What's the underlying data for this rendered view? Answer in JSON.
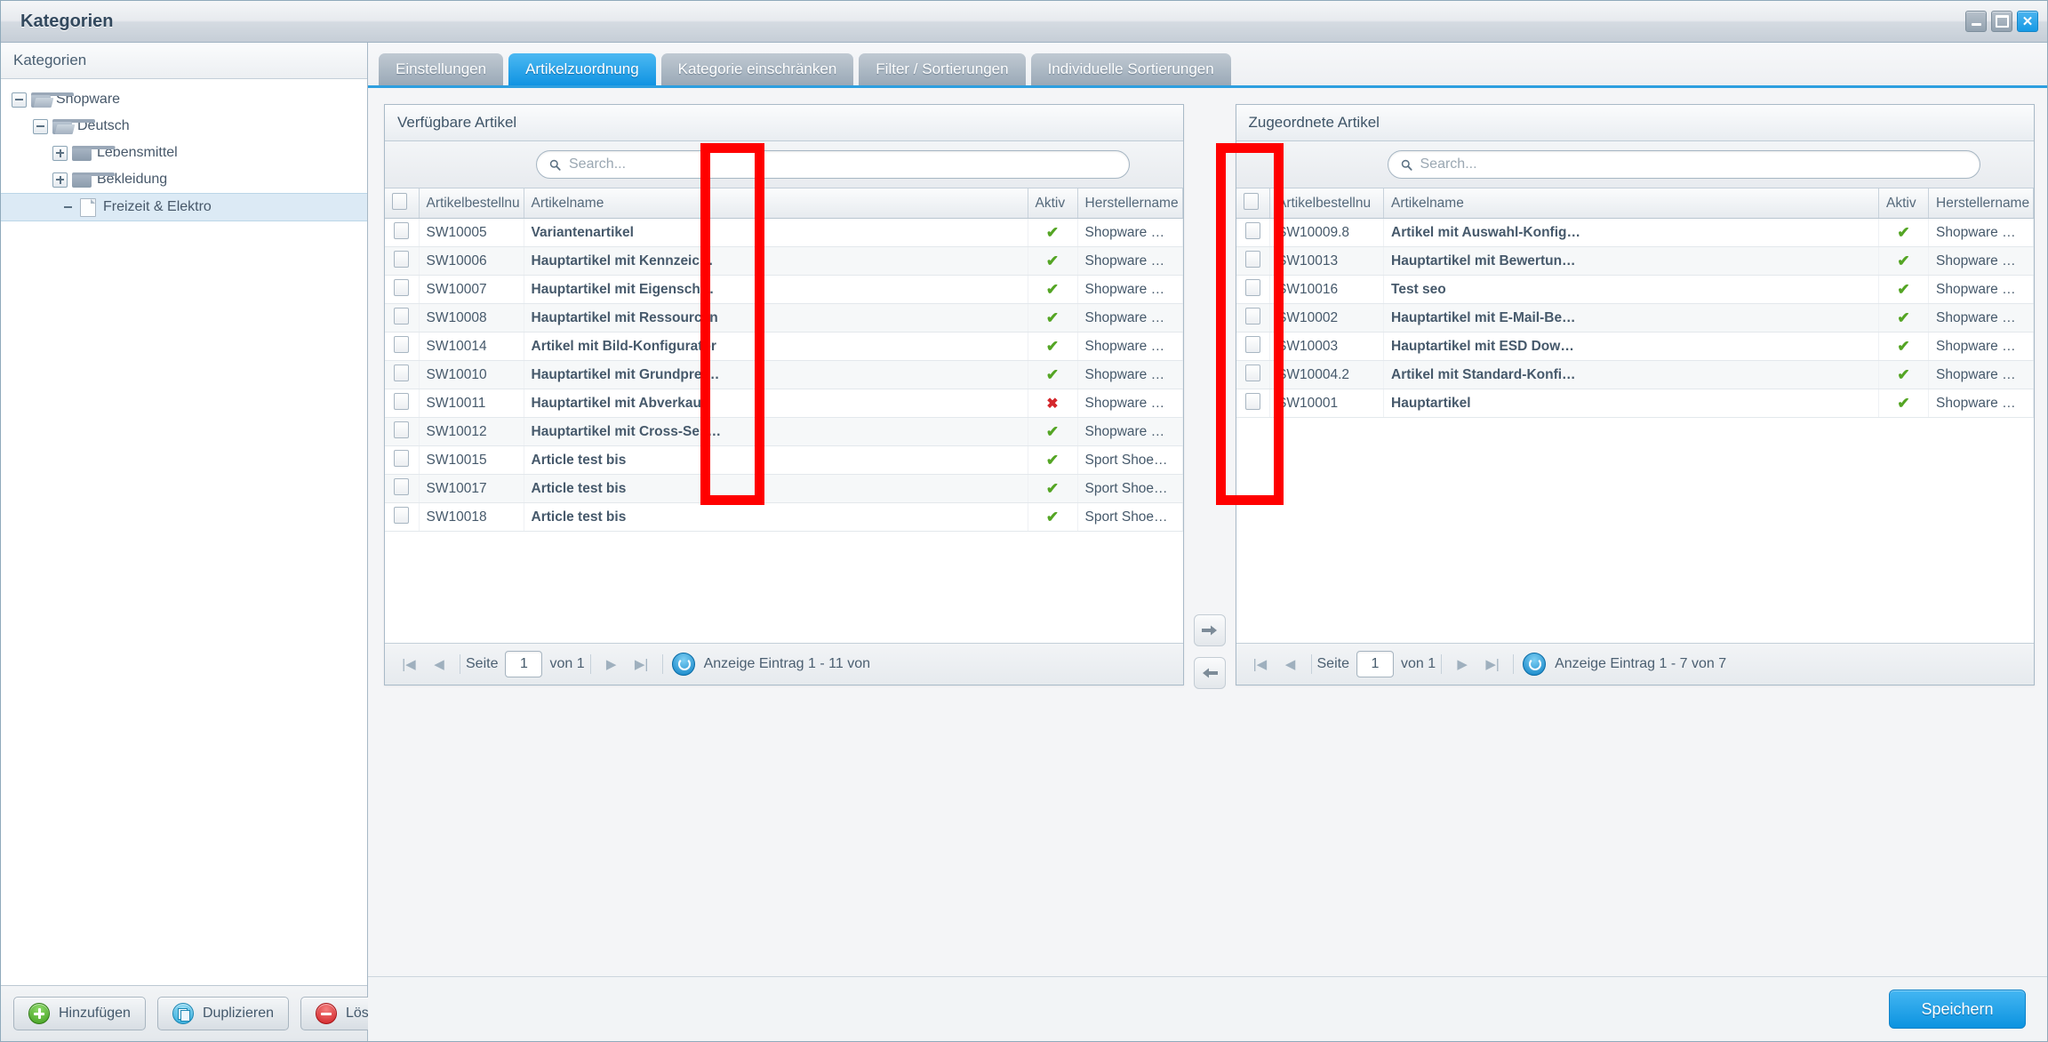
{
  "window": {
    "title": "Kategorien",
    "controls": [
      {
        "name": "minimize",
        "glyph": "—"
      },
      {
        "name": "maximize",
        "glyph": "▣"
      },
      {
        "name": "close",
        "glyph": "✕"
      }
    ]
  },
  "sidebar": {
    "header": "Kategorien",
    "tree": [
      {
        "label": "Shopware",
        "depth": 0,
        "state": "expanded",
        "icon": "folder-open-icon",
        "selected": false
      },
      {
        "label": "Deutsch",
        "depth": 1,
        "state": "expanded",
        "icon": "folder-open-icon",
        "selected": false
      },
      {
        "label": "Lebensmittel",
        "depth": 2,
        "state": "collapsed",
        "icon": "folder-icon",
        "selected": false
      },
      {
        "label": "Bekleidung",
        "depth": 2,
        "state": "collapsed",
        "icon": "folder-icon",
        "selected": false
      },
      {
        "label": "Freizeit & Elektro",
        "depth": 3,
        "state": "leaf",
        "icon": "document-icon",
        "selected": true
      }
    ],
    "footer_buttons": [
      {
        "label": "Hinzufügen",
        "icon": "plus-circle-icon",
        "color": "#3f9c1d"
      },
      {
        "label": "Duplizieren",
        "icon": "copy-circle-icon",
        "color": "#28a6d8"
      },
      {
        "label": "Löschen",
        "icon": "minus-circle-icon",
        "color": "#cf1d22"
      }
    ]
  },
  "tabs": [
    {
      "label": "Einstellungen",
      "active": false
    },
    {
      "label": "Artikelzuordnung",
      "active": true
    },
    {
      "label": "Kategorie einschränken",
      "active": false
    },
    {
      "label": "Filter / Sortierungen",
      "active": false
    },
    {
      "label": "Individuelle Sortierungen",
      "active": false
    }
  ],
  "transfer": {
    "assign_icon": "arrow-right-icon",
    "unassign_icon": "arrow-left-icon",
    "assign_glyph": "➜",
    "unassign_glyph": "➜"
  },
  "available_grid": {
    "title": "Verfügbare Artikel",
    "search_placeholder": "Search...",
    "columns": [
      "Artikelbestellnu",
      "Artikelname",
      "Aktiv",
      "Herstellername"
    ],
    "rows": [
      {
        "ordernumber": "SW10005",
        "name": "Variantenartikel",
        "active": true,
        "manufacturer": "Shopware …"
      },
      {
        "ordernumber": "SW10006",
        "name": "Hauptartikel mit Kennzeic…",
        "active": true,
        "manufacturer": "Shopware …"
      },
      {
        "ordernumber": "SW10007",
        "name": "Hauptartikel mit Eigensch…",
        "active": true,
        "manufacturer": "Shopware …"
      },
      {
        "ordernumber": "SW10008",
        "name": "Hauptartikel mit Ressourcen",
        "active": true,
        "manufacturer": "Shopware …"
      },
      {
        "ordernumber": "SW10014",
        "name": "Artikel mit Bild-Konfigurator",
        "active": true,
        "manufacturer": "Shopware …"
      },
      {
        "ordernumber": "SW10010",
        "name": "Hauptartikel mit Grundprei…",
        "active": true,
        "manufacturer": "Shopware …"
      },
      {
        "ordernumber": "SW10011",
        "name": "Hauptartikel mit Abverkauf",
        "active": false,
        "manufacturer": "Shopware …"
      },
      {
        "ordernumber": "SW10012",
        "name": "Hauptartikel mit Cross-Sell…",
        "active": true,
        "manufacturer": "Shopware …"
      },
      {
        "ordernumber": "SW10015",
        "name": "Article test bis",
        "active": true,
        "manufacturer": "Sport Shoe…"
      },
      {
        "ordernumber": "SW10017",
        "name": "Article test bis",
        "active": true,
        "manufacturer": "Sport Shoe…"
      },
      {
        "ordernumber": "SW10018",
        "name": "Article test bis",
        "active": true,
        "manufacturer": "Sport Shoe…"
      }
    ],
    "pager": {
      "page_label": "Seite",
      "page_value": "1",
      "of_label": "von 1",
      "status": "Anzeige Eintrag 1 - 11 von"
    }
  },
  "assigned_grid": {
    "title": "Zugeordnete Artikel",
    "search_placeholder": "Search...",
    "columns": [
      "Artikelbestellnu",
      "Artikelname",
      "Aktiv",
      "Herstellername"
    ],
    "rows": [
      {
        "ordernumber": "SW10009.8",
        "name": "Artikel mit Auswahl-Konfig…",
        "active": true,
        "manufacturer": "Shopware …"
      },
      {
        "ordernumber": "SW10013",
        "name": "Hauptartikel mit Bewertun…",
        "active": true,
        "manufacturer": "Shopware …"
      },
      {
        "ordernumber": "SW10016",
        "name": "Test seo",
        "active": true,
        "manufacturer": "Shopware …"
      },
      {
        "ordernumber": "SW10002",
        "name": "Hauptartikel mit E-Mail-Be…",
        "active": true,
        "manufacturer": "Shopware …"
      },
      {
        "ordernumber": "SW10003",
        "name": "Hauptartikel mit ESD Dow…",
        "active": true,
        "manufacturer": "Shopware …"
      },
      {
        "ordernumber": "SW10004.2",
        "name": "Artikel mit Standard-Konfi…",
        "active": true,
        "manufacturer": "Shopware …"
      },
      {
        "ordernumber": "SW10001",
        "name": "Hauptartikel",
        "active": true,
        "manufacturer": "Shopware …"
      }
    ],
    "pager": {
      "page_label": "Seite",
      "page_value": "1",
      "of_label": "von 1",
      "status": "Anzeige Eintrag 1 - 7 von 7"
    }
  },
  "footer": {
    "save_label": "Speichern"
  },
  "marks": {
    "active_check_glyph": "✔",
    "inactive_check_glyph": "✖",
    "annotation_color": "#ff0000"
  },
  "colors": {
    "accent": "#1093e2",
    "active_green": "#54a524",
    "inactive_red": "#d4272c",
    "title_text": "#33495e"
  }
}
